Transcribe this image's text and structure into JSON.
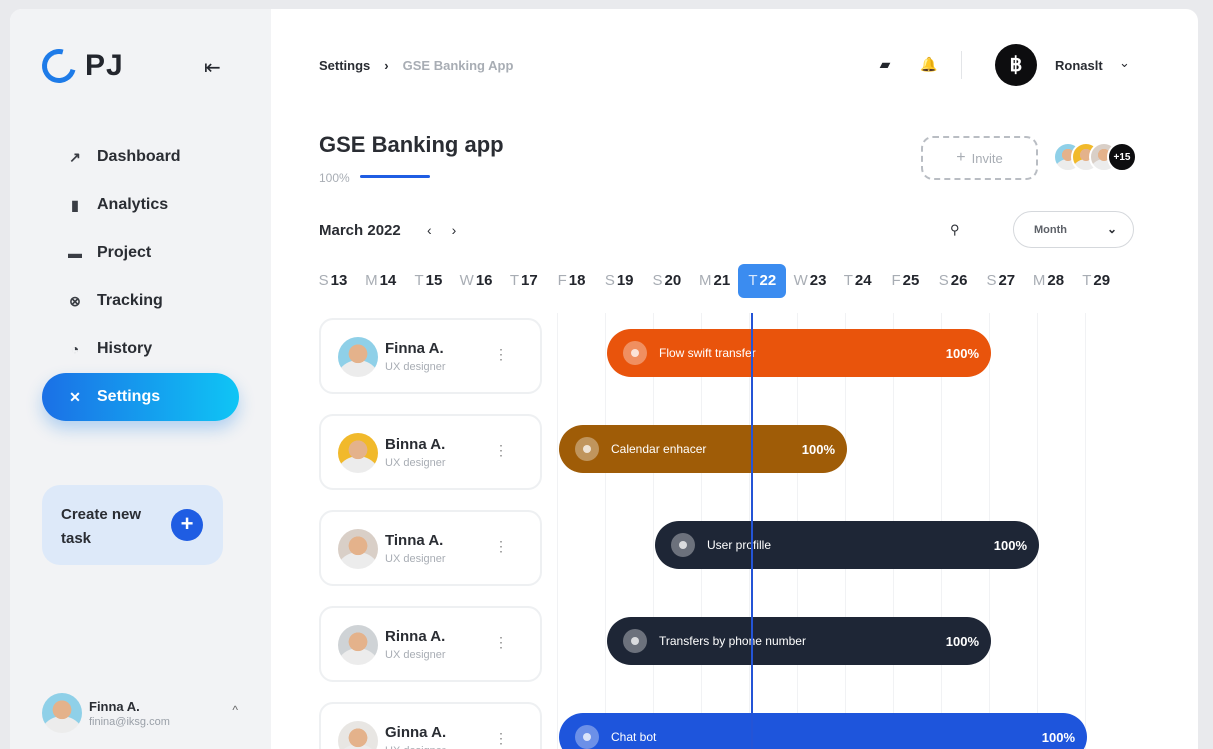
{
  "brand": {
    "logo_text": "PJ"
  },
  "sidebar": {
    "collapse_icon": "collapse-left-icon",
    "items": [
      {
        "label": "Dashboard",
        "icon": "trend-icon"
      },
      {
        "label": "Analytics",
        "icon": "bar-chart-icon"
      },
      {
        "label": "Project",
        "icon": "folder-icon"
      },
      {
        "label": "Tracking",
        "icon": "bicycle-icon"
      },
      {
        "label": "History",
        "icon": "gauge-icon"
      },
      {
        "label": "Settings",
        "icon": "tools-icon",
        "active": true
      }
    ],
    "create_task": {
      "label": "Create new task",
      "button": "+"
    },
    "user": {
      "name": "Finna A.",
      "email": "finina@iksg.com"
    }
  },
  "header": {
    "breadcrumb": [
      "Settings",
      "GSE Banking App"
    ],
    "account": {
      "name": "Ronaslt",
      "logo": "฿"
    }
  },
  "project": {
    "title": "GSE Banking app",
    "progress_label": "100%",
    "progress": 1.0,
    "invite_label": "Invite",
    "team_more": "+15"
  },
  "calendar": {
    "month_label": "March 2022",
    "view_select": "Month",
    "days": [
      {
        "w": "S",
        "d": "13"
      },
      {
        "w": "M",
        "d": "14"
      },
      {
        "w": "T",
        "d": "15"
      },
      {
        "w": "W",
        "d": "16"
      },
      {
        "w": "T",
        "d": "17"
      },
      {
        "w": "F",
        "d": "18"
      },
      {
        "w": "S",
        "d": "19"
      },
      {
        "w": "S",
        "d": "20"
      },
      {
        "w": "M",
        "d": "21"
      },
      {
        "w": "T",
        "d": "22",
        "today": true
      },
      {
        "w": "W",
        "d": "23"
      },
      {
        "w": "T",
        "d": "24"
      },
      {
        "w": "F",
        "d": "25"
      },
      {
        "w": "S",
        "d": "26"
      },
      {
        "w": "S",
        "d": "27"
      },
      {
        "w": "M",
        "d": "28"
      },
      {
        "w": "T",
        "d": "29"
      }
    ]
  },
  "people": [
    {
      "name": "Finna A.",
      "role": "UX designer"
    },
    {
      "name": "Binna A.",
      "role": "UX designer"
    },
    {
      "name": "Tinna A.",
      "role": "UX designer"
    },
    {
      "name": "Rinna A.",
      "role": "UX designer"
    },
    {
      "name": "Ginna A.",
      "role": "UX designer"
    }
  ],
  "tasks": [
    {
      "label": "Flow swift transfer",
      "pct": "100%",
      "start_day": "14",
      "end_day": "21",
      "color": "#e9540c"
    },
    {
      "label": "Calendar enhacer",
      "pct": "100%",
      "start_day": "13",
      "end_day": "18",
      "color": "#9f5c07"
    },
    {
      "label": "User profille",
      "pct": "100%",
      "start_day": "15",
      "end_day": "22",
      "color": "#1e2636"
    },
    {
      "label": "Transfers by phone number",
      "pct": "100%",
      "start_day": "14",
      "end_day": "21",
      "color": "#1e2636"
    },
    {
      "label": "Chat bot",
      "pct": "100%",
      "start_day": "13",
      "end_day": "23",
      "color": "#1e55dc"
    }
  ]
}
